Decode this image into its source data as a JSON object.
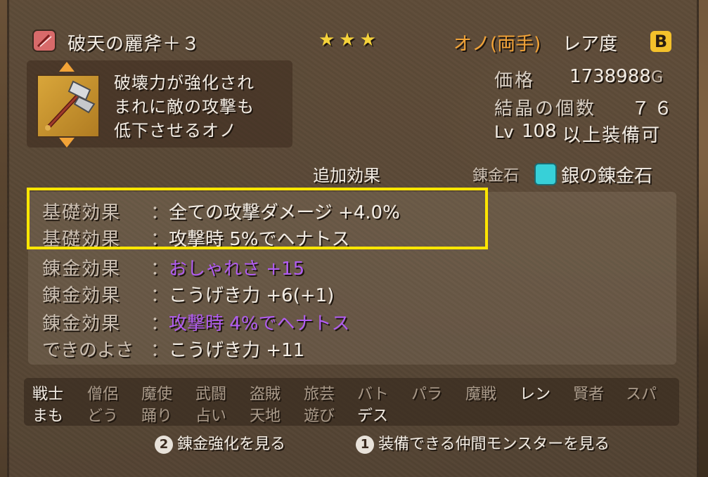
{
  "item": {
    "name": "破天の麗斧＋３",
    "stars": "★★★",
    "type": "オノ(両手)",
    "rarity_label": "レア度",
    "rarity": "B",
    "description": [
      "破壊力が強化され",
      "まれに敵の攻撃も",
      "低下させるオノ"
    ]
  },
  "stats": {
    "price_label": "価格",
    "price": "1738988",
    "price_unit": "G",
    "crystal_label": "結晶の個数",
    "crystal": "７６",
    "level_prefix": "Lv",
    "level": "108",
    "level_suffix": "以上装備可"
  },
  "effects_header": {
    "title": "追加効果",
    "stone_label": "錬金石",
    "stone_name": "銀の錬金石"
  },
  "effects": [
    {
      "label": "基礎効果",
      "value": "全ての攻撃ダメージ +4.0%",
      "color": "#f2ece4"
    },
    {
      "label": "基礎効果",
      "value": "攻撃時 5%でヘナトス",
      "color": "#f2ece4"
    },
    {
      "label": "錬金効果",
      "value": "おしゃれさ +15",
      "color": "#b05cf0"
    },
    {
      "label": "錬金効果",
      "value": "こうげき力 +6(+1)",
      "color": "#f2ece4"
    },
    {
      "label": "錬金効果",
      "value": "攻撃時 4%でヘナトス",
      "color": "#b05cf0"
    },
    {
      "label": "できのよさ",
      "value": "こうげき力 +11",
      "color": "#f2ece4"
    }
  ],
  "jobs_row1": [
    {
      "name": "戦士",
      "on": true
    },
    {
      "name": "僧侶",
      "on": false
    },
    {
      "name": "魔使",
      "on": false
    },
    {
      "name": "武闘",
      "on": false
    },
    {
      "name": "盗賊",
      "on": false
    },
    {
      "name": "旅芸",
      "on": false
    },
    {
      "name": "バト",
      "on": false
    },
    {
      "name": "パラ",
      "on": false
    },
    {
      "name": "魔戦",
      "on": false
    },
    {
      "name": "レン",
      "on": true
    },
    {
      "name": "賢者",
      "on": false
    },
    {
      "name": "スパ",
      "on": false
    }
  ],
  "jobs_row2": [
    {
      "name": "まも",
      "on": true
    },
    {
      "name": "どう",
      "on": false
    },
    {
      "name": "踊り",
      "on": false
    },
    {
      "name": "占い",
      "on": false
    },
    {
      "name": "天地",
      "on": false
    },
    {
      "name": "遊び",
      "on": false
    },
    {
      "name": "デス",
      "on": true
    }
  ],
  "footer": {
    "btn2_key": "2",
    "btn2_label": "錬金強化を見る",
    "btn1_key": "1",
    "btn1_label": "装備できる仲間モンスターを見る"
  },
  "colors": {
    "accent_orange": "#f2a337",
    "star_yellow": "#f5d23b",
    "highlight_yellow": "#ffe600",
    "purple": "#b05cf0"
  }
}
